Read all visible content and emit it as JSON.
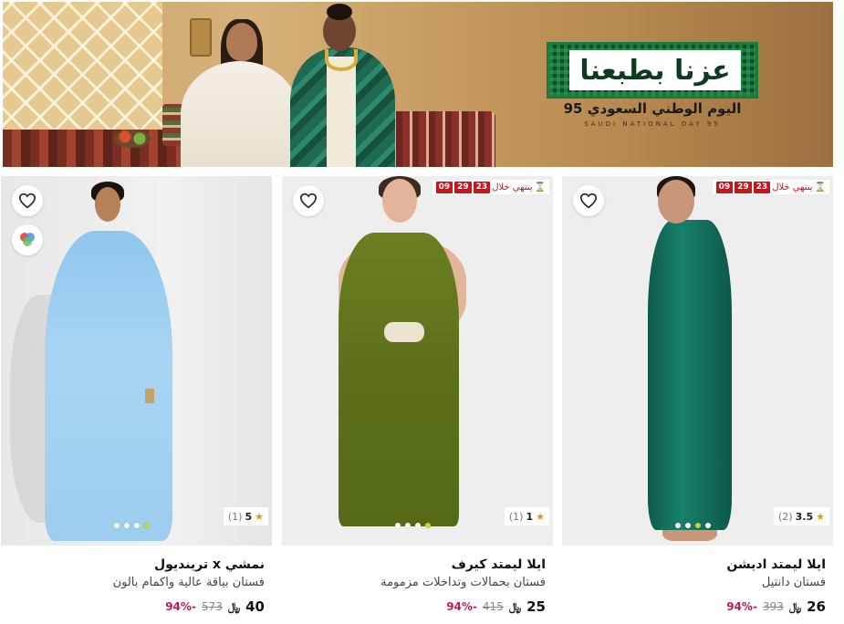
{
  "banner": {
    "logo_text": "عزنا بطبعنا",
    "subtitle": "اليوم الوطني السعودي 95",
    "subtitle_en": "SAUDI NATIONAL DAY 95",
    "colors": {
      "logo_green": "#0d4b2a"
    }
  },
  "timer": {
    "label": "ينتهي خلال",
    "icon": "hourglass-icon",
    "hours": "23",
    "minutes": "29",
    "seconds": "09",
    "color": "#c9141c"
  },
  "currency_symbol": "﷼",
  "products": [
    {
      "brand": "نمشي x ترينديول",
      "description": "فستان بياقة عالية واكمام بالون",
      "price": "40",
      "old_price": "573",
      "discount": "-94%",
      "rating": "5",
      "reviews": "(1)",
      "has_timer": false,
      "has_colors_button": true,
      "image_dots": 4,
      "active_dot": 3
    },
    {
      "brand": "ايلا ليمتد كيرف",
      "description": "فستان بحمالات وتداخلات مزمومة",
      "price": "25",
      "old_price": "415",
      "discount": "-94%",
      "rating": "1",
      "reviews": "(1)",
      "has_timer": true,
      "has_colors_button": false,
      "image_dots": 4,
      "active_dot": 3
    },
    {
      "brand": "ايلا ليمتد اديشن",
      "description": "فستان دانتيل",
      "price": "26",
      "old_price": "393",
      "discount": "-94%",
      "rating": "3.5",
      "reviews": "(2)",
      "has_timer": true,
      "has_colors_button": false,
      "image_dots": 4,
      "active_dot": 2
    }
  ],
  "colors": {
    "discount": "#b41e5a",
    "star": "#e0961a",
    "active_dot": "#c9d63a"
  }
}
